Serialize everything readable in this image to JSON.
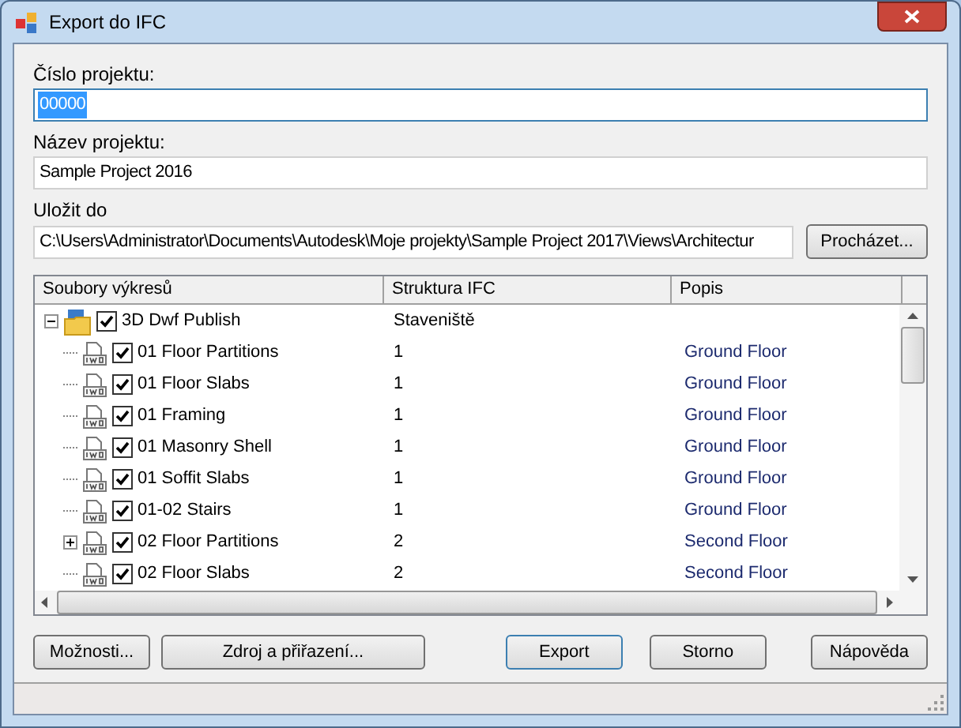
{
  "window": {
    "title": "Export do IFC"
  },
  "fields": [
    {
      "label": "Číslo projektu:",
      "value": "00000",
      "focused": true
    },
    {
      "label": "Název projektu:",
      "value": "Sample Project 2016",
      "focused": false
    },
    {
      "label": "Uložit do",
      "value": "C:\\Users\\Administrator\\Documents\\Autodesk\\Moje projekty\\Sample Project 2017\\Views\\Architectur",
      "focused": false,
      "button": "Procházet..."
    }
  ],
  "tree": {
    "columns": [
      "Soubory výkresů",
      "Struktura IFC",
      "Popis"
    ],
    "root": {
      "kind": "folder",
      "name": "3D Dwf Publish",
      "structure": "Staveniště",
      "expanded": true,
      "checked": true,
      "children": [
        {
          "kind": "file",
          "name": "01 Floor Partitions",
          "structure": "1",
          "description": "Ground Floor",
          "checked": true
        },
        {
          "kind": "file",
          "name": "01 Floor Slabs",
          "structure": "1",
          "description": "Ground Floor",
          "checked": true
        },
        {
          "kind": "file",
          "name": "01 Framing",
          "structure": "1",
          "description": "Ground Floor",
          "checked": true
        },
        {
          "kind": "file",
          "name": "01 Masonry Shell",
          "structure": "1",
          "description": "Ground Floor",
          "checked": true
        },
        {
          "kind": "file",
          "name": "01 Soffit Slabs",
          "structure": "1",
          "description": "Ground Floor",
          "checked": true
        },
        {
          "kind": "file",
          "name": "01-02 Stairs",
          "structure": "1",
          "description": "Ground Floor",
          "checked": true
        },
        {
          "kind": "group",
          "name": "02 Floor Partitions",
          "structure": "2",
          "description": "Second Floor",
          "checked": true,
          "expanded": false
        },
        {
          "kind": "file",
          "name": "02 Floor Slabs",
          "structure": "2",
          "description": "Second Floor",
          "checked": true
        }
      ]
    }
  },
  "buttons": [
    {
      "label": "Možnosti...",
      "default": false
    },
    {
      "label": "Zdroj a přiřazení...",
      "default": false
    },
    {
      "label": "Export",
      "default": true
    },
    {
      "label": "Storno",
      "default": false
    },
    {
      "label": "Nápověda",
      "default": false
    }
  ]
}
